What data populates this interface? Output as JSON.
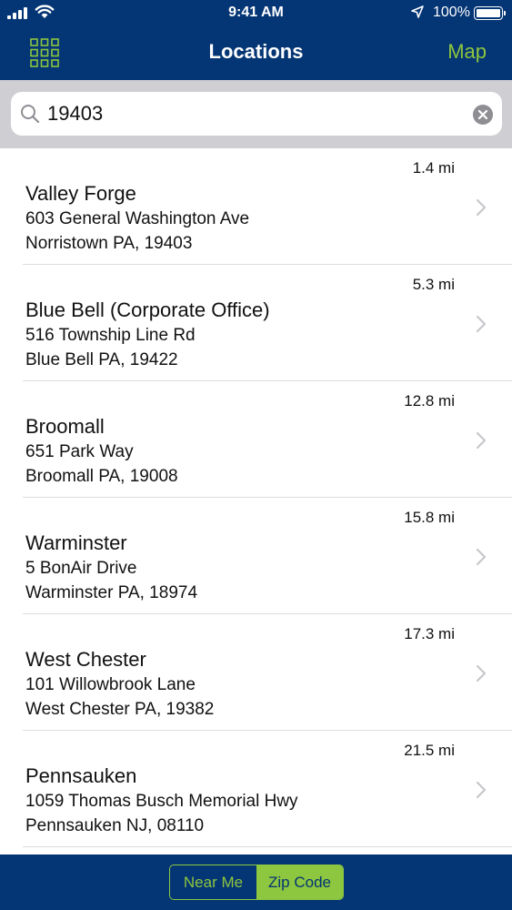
{
  "status_bar": {
    "time": "9:41 AM",
    "battery": "100%",
    "icons": [
      "signal-icon",
      "wifi-icon",
      "location-arrow-icon",
      "battery-icon"
    ]
  },
  "nav": {
    "title": "Locations",
    "map_label": "Map",
    "left_icon": "grid-menu-icon"
  },
  "search": {
    "value": "19403",
    "icon": "search-icon",
    "clear_icon": "clear-icon"
  },
  "locations": [
    {
      "distance": "1.4 mi",
      "name": "Valley Forge",
      "address1": "603 General Washington Ave",
      "address2": "Norristown PA, 19403"
    },
    {
      "distance": "5.3 mi",
      "name": "Blue Bell (Corporate Office)",
      "address1": "516 Township Line Rd",
      "address2": "Blue Bell PA, 19422"
    },
    {
      "distance": "12.8 mi",
      "name": "Broomall",
      "address1": "651 Park Way",
      "address2": "Broomall PA, 19008"
    },
    {
      "distance": "15.8 mi",
      "name": "Warminster",
      "address1": "5 BonAir Drive",
      "address2": "Warminster PA, 18974"
    },
    {
      "distance": "17.3 mi",
      "name": "West Chester",
      "address1": "101 Willowbrook Lane",
      "address2": "West Chester PA, 19382"
    },
    {
      "distance": "21.5 mi",
      "name": "Pennsauken",
      "address1": "1059 Thomas Busch Memorial Hwy",
      "address2": "Pennsauken NJ, 08110"
    }
  ],
  "segmented": {
    "near_me": "Near Me",
    "zip_code": "Zip Code",
    "selected": "Zip Code"
  },
  "colors": {
    "navy": "#043574",
    "accent_green": "#8dc63f",
    "search_bg": "#cfcfd3"
  }
}
